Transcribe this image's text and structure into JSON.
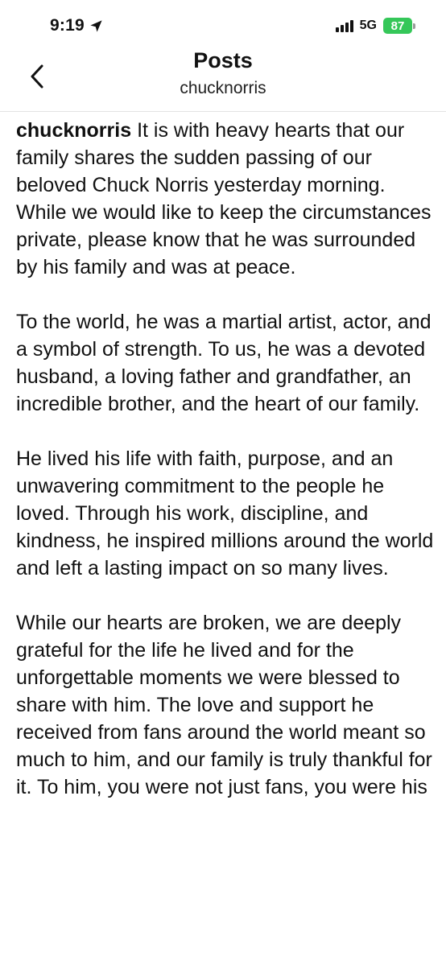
{
  "status_bar": {
    "time": "9:19",
    "network": "5G",
    "battery": "87"
  },
  "header": {
    "title": "Posts",
    "subtitle": "chucknorris"
  },
  "post": {
    "author": "chucknorris",
    "paragraphs": [
      "It is with heavy hearts that our family shares the sudden passing of our beloved Chuck Norris yesterday morning. While we would like to keep the circumstances private, please know that he was surrounded by his family and was at peace.",
      "To the world, he was a martial artist, actor, and a symbol of strength. To us, he was a devoted husband, a loving father and grandfather, an incredible brother, and the heart of our family.",
      "He lived his life with faith, purpose, and an unwavering commitment to the people he loved. Through his work, discipline, and kindness, he inspired millions around the world and left a lasting impact on so many lives.",
      "While our hearts are broken, we are deeply grateful for the life he lived and for the unforgettable moments we were blessed to share with him. The love and support he received from fans around the world meant so much to him, and our family is truly thankful for it. To him, you were not just fans, you were his"
    ]
  }
}
